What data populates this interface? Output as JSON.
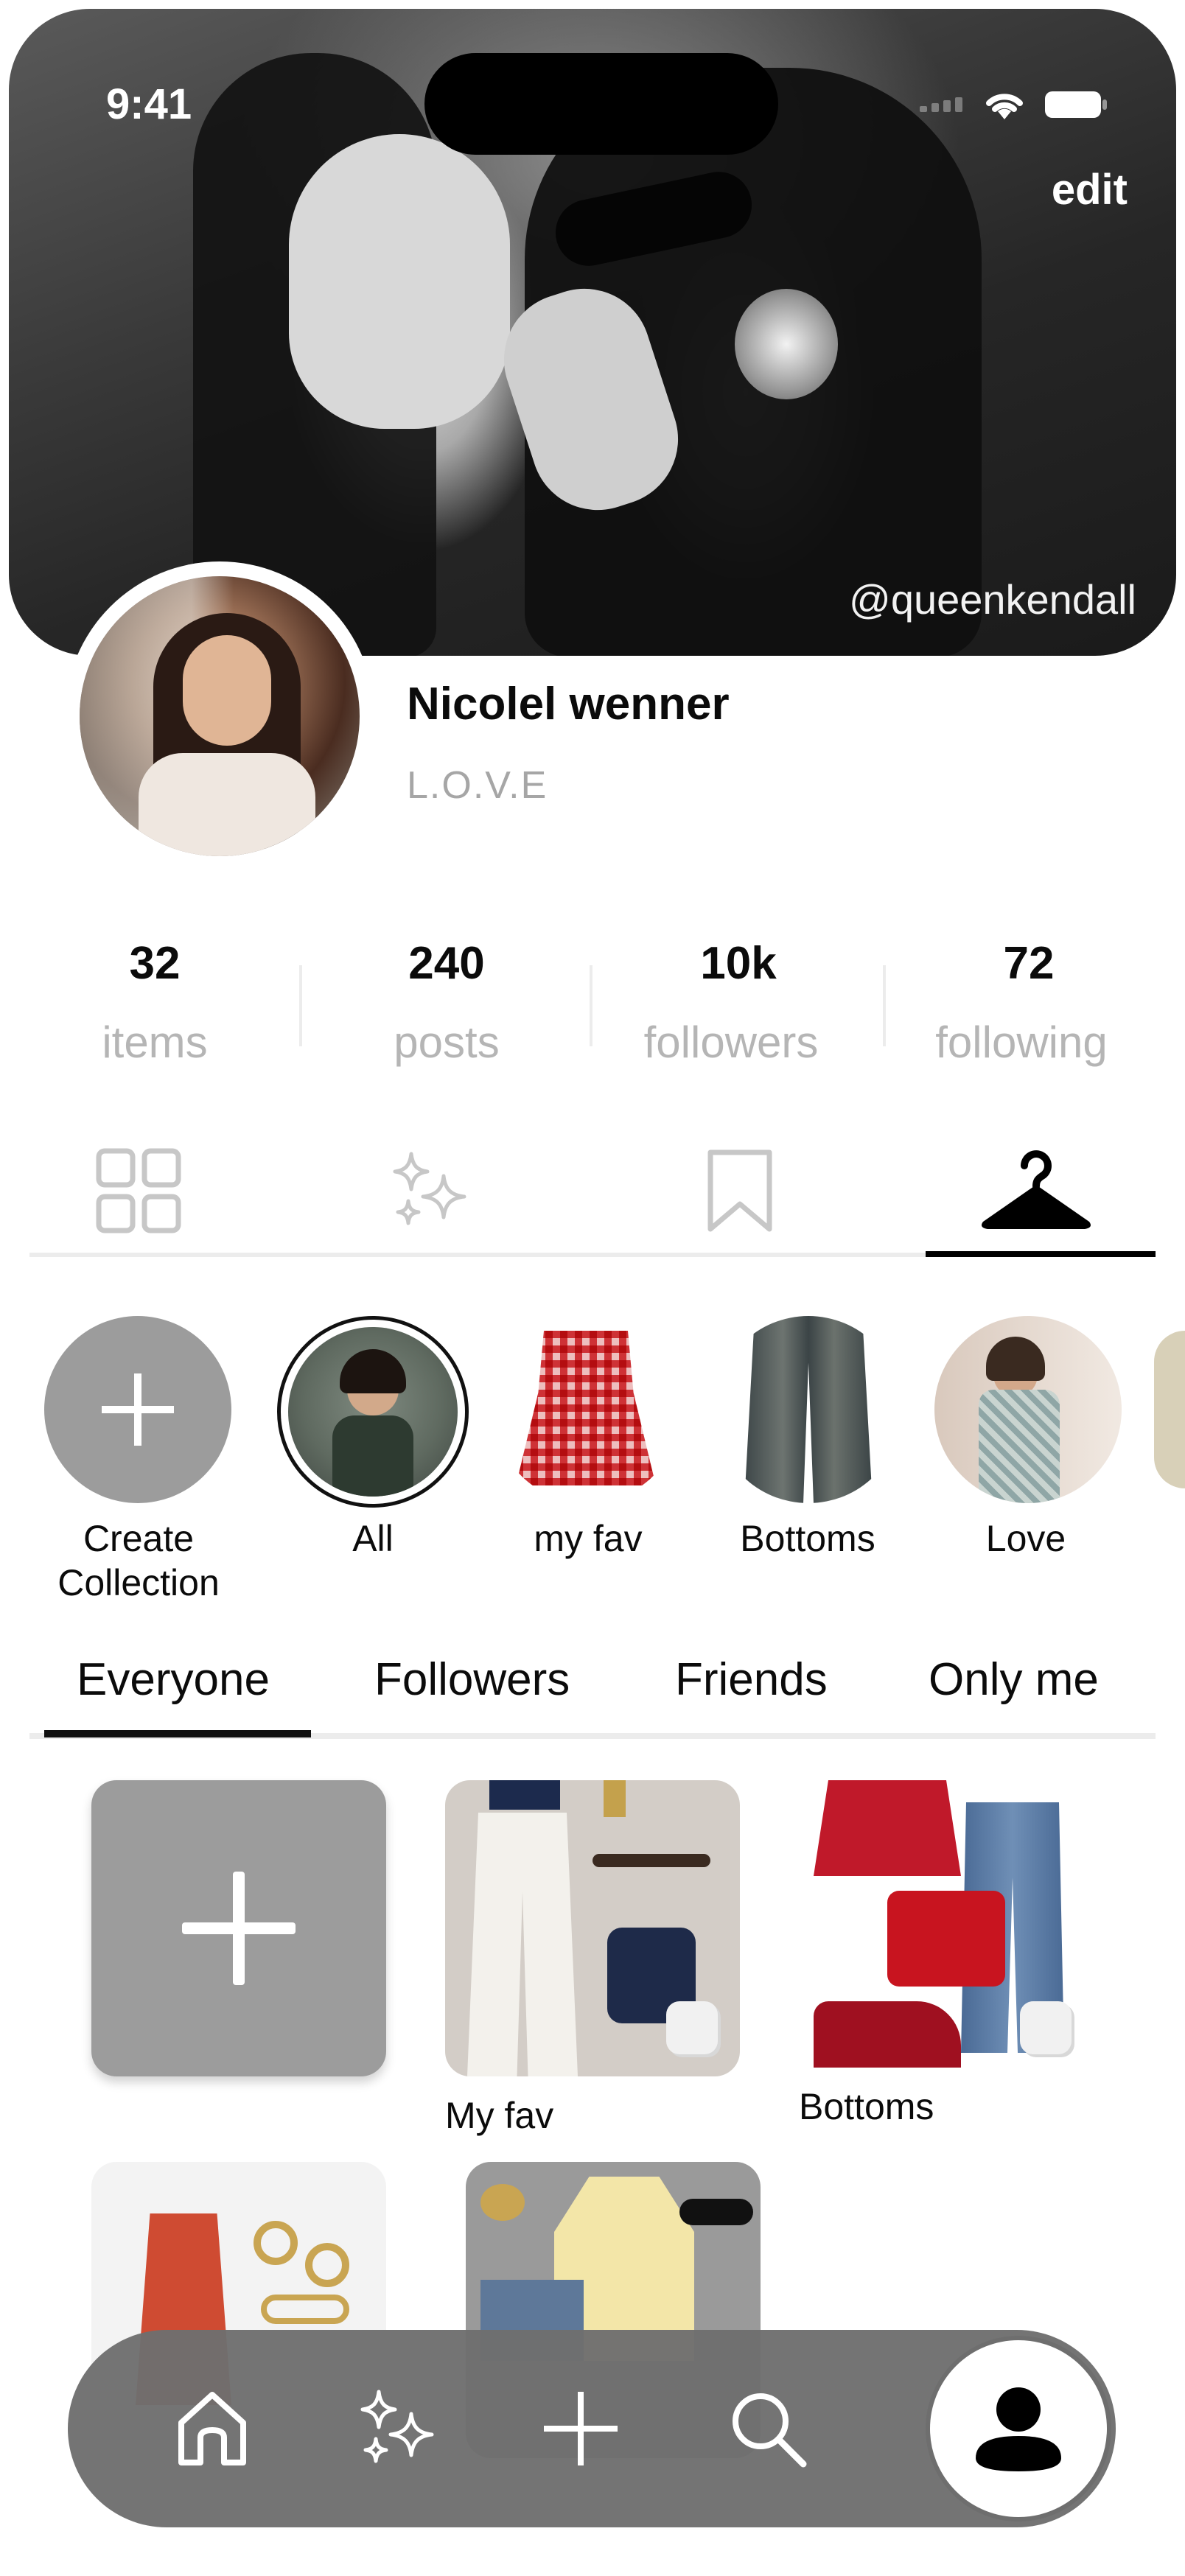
{
  "status_bar": {
    "time": "9:41"
  },
  "header": {
    "edit_label": "edit",
    "handle": "@queenkendall"
  },
  "profile": {
    "name": "Nicolel wenner",
    "bio": "L.O.V.E"
  },
  "stats": [
    {
      "value": "32",
      "label": "items"
    },
    {
      "value": "240",
      "label": "posts"
    },
    {
      "value": "10k",
      "label": "followers"
    },
    {
      "value": "72",
      "label": "following"
    }
  ],
  "content_tabs": [
    {
      "icon": "grid-icon",
      "active": false
    },
    {
      "icon": "sparkles-icon",
      "active": false
    },
    {
      "icon": "bookmark-icon",
      "active": false
    },
    {
      "icon": "hanger-icon",
      "active": true
    }
  ],
  "collections": [
    {
      "label": "Create\nCollection",
      "line1": "Create",
      "line2": "Collection",
      "icon": "plus-icon"
    },
    {
      "label": "All"
    },
    {
      "label": "my fav"
    },
    {
      "label": "Bottoms"
    },
    {
      "label": "Love"
    }
  ],
  "privacy_tabs": [
    {
      "label": "Everyone",
      "active": true
    },
    {
      "label": "Followers",
      "active": false
    },
    {
      "label": "Friends",
      "active": false
    },
    {
      "label": "Only me",
      "active": false
    }
  ],
  "grid": {
    "add_icon": "plus-icon",
    "items": [
      {
        "label": "My fav"
      },
      {
        "label": "Bottoms"
      },
      {
        "label": ""
      },
      {
        "label": ""
      }
    ]
  },
  "bottom_nav": {
    "items": [
      "home-icon",
      "sparkles-icon",
      "plus-icon",
      "search-icon",
      "profile-icon"
    ],
    "active": "profile-icon"
  },
  "colors": {
    "accent": "#000000",
    "muted_text": "#b5b5b5",
    "nav_bg": "#6e6e6e",
    "card_gray": "#9c9c9c"
  }
}
